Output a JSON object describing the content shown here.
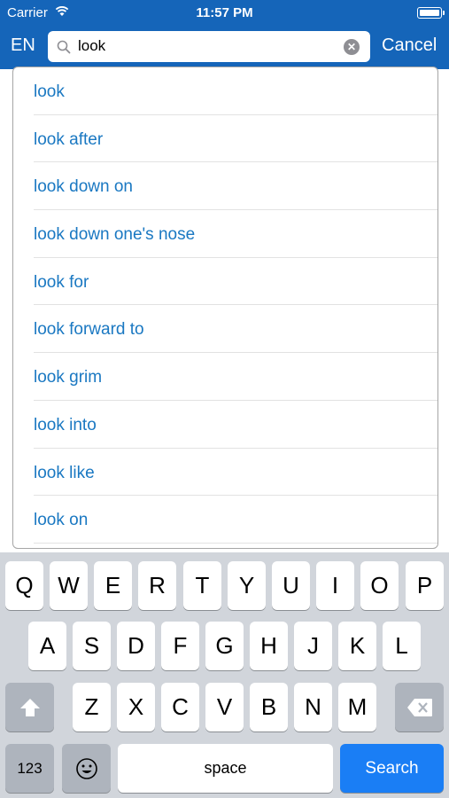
{
  "status": {
    "carrier": "Carrier",
    "time": "11:57 PM"
  },
  "header": {
    "lang": "EN",
    "search_value": "look",
    "cancel": "Cancel"
  },
  "suggestions": [
    "look",
    "look after",
    "look down on",
    "look down one's nose",
    "look for",
    "look forward to",
    "look grim",
    "look into",
    "look like",
    "look on"
  ],
  "keyboard": {
    "row1": [
      "Q",
      "W",
      "E",
      "R",
      "T",
      "Y",
      "U",
      "I",
      "O",
      "P"
    ],
    "row2": [
      "A",
      "S",
      "D",
      "F",
      "G",
      "H",
      "J",
      "K",
      "L"
    ],
    "row3": [
      "Z",
      "X",
      "C",
      "V",
      "B",
      "N",
      "M"
    ],
    "numbers_label": "123",
    "space_label": "space",
    "search_label": "Search"
  },
  "colors": {
    "header": "#1565b9",
    "link": "#1a78c2",
    "search_key": "#1a7ef5"
  }
}
